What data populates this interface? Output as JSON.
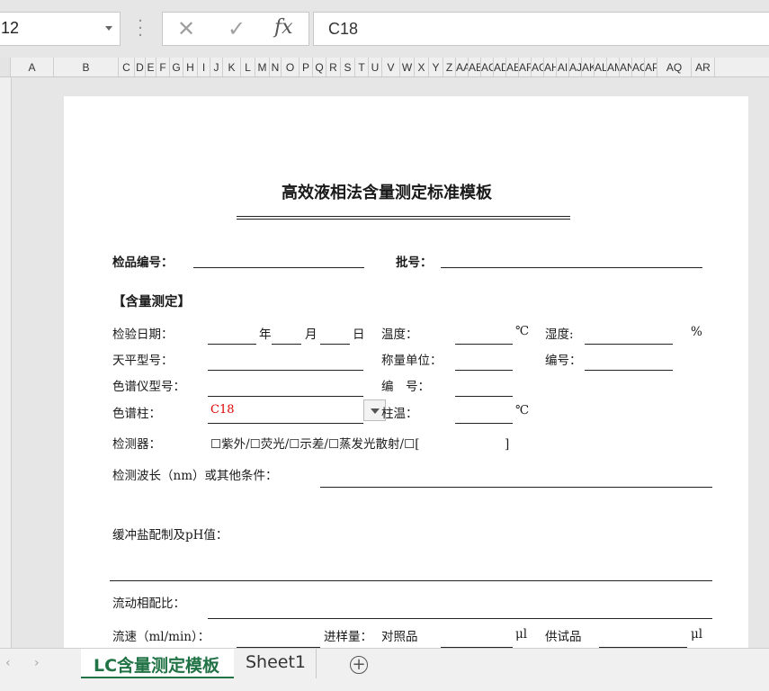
{
  "formula_bar": {
    "name_box": "12",
    "cancel_icon": "✕",
    "enter_icon": "✓",
    "fx_label": "fx",
    "formula_value": "C18"
  },
  "columns": [
    "A",
    "B",
    "C",
    "D",
    "E",
    "F",
    "G",
    "H",
    "I",
    "J",
    "K",
    "L",
    "M",
    "N",
    "O",
    "P",
    "Q",
    "R",
    "S",
    "T",
    "U",
    "V",
    "W",
    "X",
    "Y",
    "Z",
    "AA",
    "AB",
    "AC",
    "AD",
    "AE",
    "AF",
    "AG",
    "AH",
    "AI",
    "AJ",
    "AK",
    "AL",
    "AM",
    "AN",
    "AO",
    "AP",
    "AQ",
    "AR"
  ],
  "document": {
    "title": "高效液相法含量测定标准模板",
    "sample_no_label": "检品编号：",
    "batch_no_label": "批号：",
    "section_title": "【含量测定】",
    "test_date_label": "检验日期：",
    "year": "年",
    "month": "月",
    "day": "日",
    "temperature_label": "温度：",
    "celsius": "℃",
    "humidity_label": "湿度:",
    "percent": "%",
    "balance_model_label": "天平型号：",
    "weighing_unit_label": "称量单位：",
    "balance_number_label": "编号：",
    "chromatograph_model_label": "色谱仪型号：",
    "chromatograph_number_label": "编　号：",
    "column_label": "色谱柱：",
    "column_value": "C18",
    "column_temp_label": "柱温：",
    "column_temp_unit": "℃",
    "detector_label": "检测器：",
    "detector_options": "☐紫外/☐荧光/☐示差/☐蒸发光散射/☐[　　　　　　　]",
    "wavelength_label": "检测波长（nm）或其他条件：",
    "buffer_label": "缓冲盐配制及pH值：",
    "mobile_phase_label": "流动相配比：",
    "flow_rate_label": "流速（ml/min）：",
    "injection_label": "进样量：",
    "reference_label": "对照品",
    "ul_unit": "μl",
    "sample_label": "供试品",
    "ul_unit2": "μl"
  },
  "tabs": {
    "active": "LC含量测定模板",
    "second": "Sheet1",
    "add": "+"
  },
  "colors": {
    "accent": "#217346",
    "value_red": "#e00000"
  }
}
